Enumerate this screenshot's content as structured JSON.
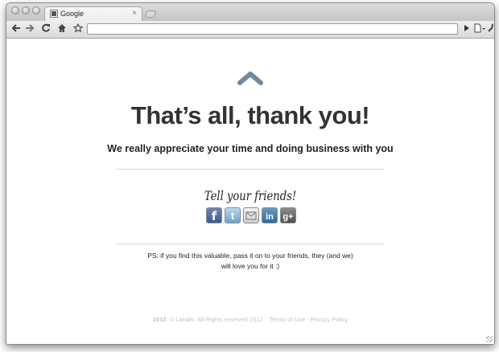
{
  "browser": {
    "tab_title": "Google",
    "tab_close": "×",
    "nav": {
      "back_icon": "arrow-left",
      "forward_icon": "arrow-right",
      "reload_icon": "reload",
      "home_icon": "home",
      "bookmark_icon": "star",
      "play_icon": "play",
      "page_menu_icon": "page",
      "wrench_icon": "wrench"
    },
    "address": ""
  },
  "page": {
    "heading": "That’s all, thank you!",
    "subheading": "We really appreciate your time and doing business with you",
    "tell_friends": "Tell your friends!",
    "social": [
      {
        "name": "facebook",
        "label": "f",
        "color": "#3b5998"
      },
      {
        "name": "twitter",
        "label": "t",
        "color": "#5fa9dd"
      },
      {
        "name": "email",
        "label": "",
        "color": "#d9d9d9"
      },
      {
        "name": "linkedin",
        "label": "in",
        "color": "#2e6b9c"
      },
      {
        "name": "google-plus",
        "label": "g+",
        "color": "#5a5a5a"
      }
    ],
    "ps_line1": "PS: if you find this valuable, pass it on to your friends, they (and we)",
    "ps_line2": "will love you for it :)",
    "footer": {
      "year": "2012",
      "copyright": ". © Lander. All Rights reserved 2012",
      "terms": "Terms of Use",
      "separator": "-",
      "privacy": "Privacy Policy"
    },
    "accent_color": "#6f8aa2"
  }
}
